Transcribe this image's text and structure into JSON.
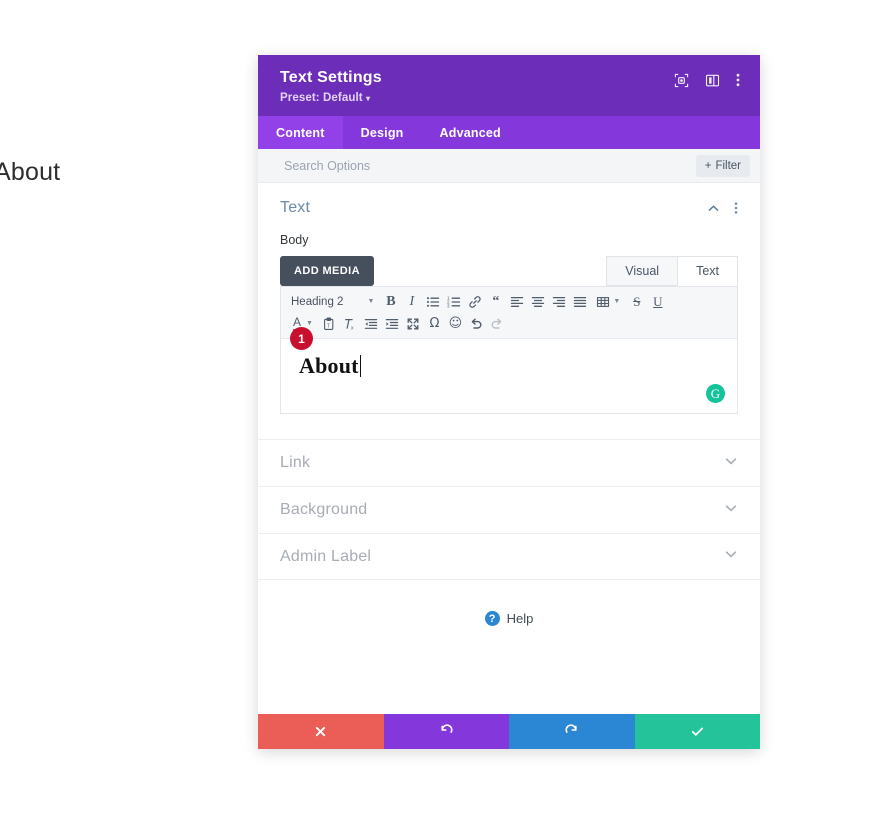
{
  "page": {
    "background_heading": "About"
  },
  "modal": {
    "title": "Text Settings",
    "preset": "Preset: Default",
    "preset_caret": "▾",
    "header_icons": [
      {
        "name": "focus-icon",
        "label": "Focus"
      },
      {
        "name": "layout-icon",
        "label": "Layout"
      },
      {
        "name": "kebab-menu-icon",
        "label": "More options"
      }
    ],
    "tabs": [
      {
        "label": "Content",
        "active": true
      },
      {
        "label": "Design",
        "active": false
      },
      {
        "label": "Advanced",
        "active": false
      }
    ],
    "search": {
      "placeholder": "Search Options",
      "value": ""
    },
    "filter_button": {
      "label": "Filter",
      "plus": "+"
    }
  },
  "text_section": {
    "title": "Text",
    "collapse_icon": "chevron-up",
    "menu_icon": "kebab",
    "body_label": "Body",
    "add_media_label": "ADD MEDIA",
    "editor_tabs": [
      {
        "label": "Visual",
        "active": false
      },
      {
        "label": "Text",
        "active": true
      }
    ],
    "toolbar": {
      "format_select": "Heading 2",
      "row1": [
        {
          "name": "bold-icon",
          "glyph": "B"
        },
        {
          "name": "italic-icon",
          "glyph": "I"
        },
        {
          "name": "bulleted-list-icon",
          "glyph": "list-ul"
        },
        {
          "name": "numbered-list-icon",
          "glyph": "list-ol"
        },
        {
          "name": "link-icon",
          "glyph": "link"
        },
        {
          "name": "blockquote-icon",
          "glyph": "quote"
        },
        {
          "name": "align-left-icon",
          "glyph": "align-left"
        },
        {
          "name": "align-center-icon",
          "glyph": "align-center"
        },
        {
          "name": "align-right-icon",
          "glyph": "align-right"
        },
        {
          "name": "align-justify-icon",
          "glyph": "align-justify"
        },
        {
          "name": "table-icon",
          "glyph": "table"
        },
        {
          "name": "strikethrough-icon",
          "glyph": "S"
        },
        {
          "name": "underline-icon",
          "glyph": "U"
        }
      ],
      "row2": [
        {
          "name": "text-color-icon",
          "glyph": "A"
        },
        {
          "name": "paste-as-text-icon",
          "glyph": "paste"
        },
        {
          "name": "clear-formatting-icon",
          "glyph": "Tx"
        },
        {
          "name": "decrease-indent-icon",
          "glyph": "outdent"
        },
        {
          "name": "increase-indent-icon",
          "glyph": "indent"
        },
        {
          "name": "fullscreen-icon",
          "glyph": "expand"
        },
        {
          "name": "special-character-icon",
          "glyph": "Ω"
        },
        {
          "name": "emoji-icon",
          "glyph": "☺"
        },
        {
          "name": "undo-icon",
          "glyph": "undo"
        },
        {
          "name": "redo-icon",
          "glyph": "redo"
        }
      ]
    },
    "content": "About",
    "grammarly_icon_label": "G",
    "step_badge": "1"
  },
  "accordions": [
    {
      "label": "Link",
      "expanded": false
    },
    {
      "label": "Background",
      "expanded": false
    },
    {
      "label": "Admin Label",
      "expanded": false
    }
  ],
  "help": {
    "icon": "?",
    "label": "Help"
  },
  "footer": [
    {
      "name": "cancel-button",
      "icon": "✖",
      "color": "#eb5d57"
    },
    {
      "name": "undo-button",
      "icon": "↺",
      "color": "#8438DB"
    },
    {
      "name": "redo-button",
      "icon": "↻",
      "color": "#2b87d3"
    },
    {
      "name": "save-button",
      "icon": "✔",
      "color": "#24c39a"
    }
  ],
  "colors": {
    "header_purple": "#6C2EB9",
    "tabbar_purple": "#8438DB",
    "tab_active_purple": "#9241E8",
    "badge_red": "#c8102e",
    "grammarly_green": "#15c39a"
  }
}
